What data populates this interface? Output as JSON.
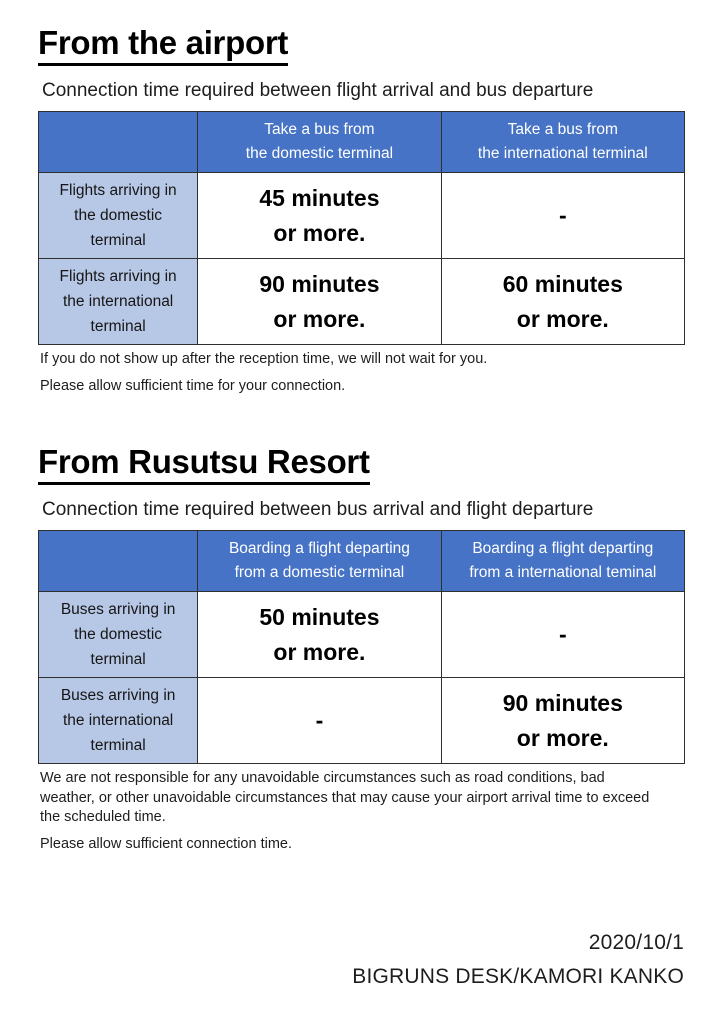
{
  "doc": {
    "background": "#ffffff",
    "header_fill": "#4673c6",
    "row_label_fill": "#b7c7e6",
    "border_color": "#2f2f2f",
    "text_color": "#1d1d1d"
  },
  "sections": [
    {
      "heading": "From the airport",
      "subtitle": "Connection time required between flight arrival and bus departure",
      "table": {
        "corner_header": "",
        "headers": [
          {
            "line1": "Take a bus from",
            "line2": "the domestic terminal"
          },
          {
            "line1": "Take a bus from",
            "line2": "the international terminal"
          }
        ],
        "rows": [
          {
            "label": {
              "line1": "Flights arriving in",
              "line2": "the domestic",
              "line3": "terminal"
            },
            "cells": [
              {
                "line1": "45 minutes",
                "line2": "or more."
              },
              {
                "line1": "-",
                "line2": ""
              }
            ]
          },
          {
            "label": {
              "line1": "Flights arriving in",
              "line2": "the international",
              "line3": "terminal"
            },
            "cells": [
              {
                "line1": "90 minutes",
                "line2": "or more."
              },
              {
                "line1": "60 minutes",
                "line2": "or more."
              }
            ]
          }
        ]
      },
      "notes": [
        "If you do not show up after the reception time, we will not wait for you.",
        "Please allow sufficient time for your connection."
      ]
    },
    {
      "heading": "From Rusutsu Resort",
      "subtitle": "Connection time required between bus arrival and flight departure",
      "table": {
        "corner_header": "",
        "headers": [
          {
            "line1": "Boarding a flight departing",
            "line2": "from a domestic terminal"
          },
          {
            "line1": "Boarding a flight departing",
            "line2": "from a international teminal"
          }
        ],
        "rows": [
          {
            "label": {
              "line1": "Buses arriving in",
              "line2": "the domestic",
              "line3": "terminal"
            },
            "cells": [
              {
                "line1": "50 minutes",
                "line2": "or more."
              },
              {
                "line1": "-",
                "line2": ""
              }
            ]
          },
          {
            "label": {
              "line1": "Buses arriving in",
              "line2": "the international",
              "line3": "terminal"
            },
            "cells": [
              {
                "line1": "-",
                "line2": ""
              },
              {
                "line1": "90 minutes",
                "line2": "or more."
              }
            ]
          }
        ]
      },
      "notes": [
        "We are not responsible for any unavoidable circumstances such as road conditions, bad weather, or other unavoidable circumstances that may cause your airport arrival time to exceed the scheduled time.",
        "Please allow sufficient connection time."
      ]
    }
  ],
  "footer": {
    "date": "2020/10/1",
    "organization": "BIGRUNS DESK/KAMORI KANKO"
  }
}
